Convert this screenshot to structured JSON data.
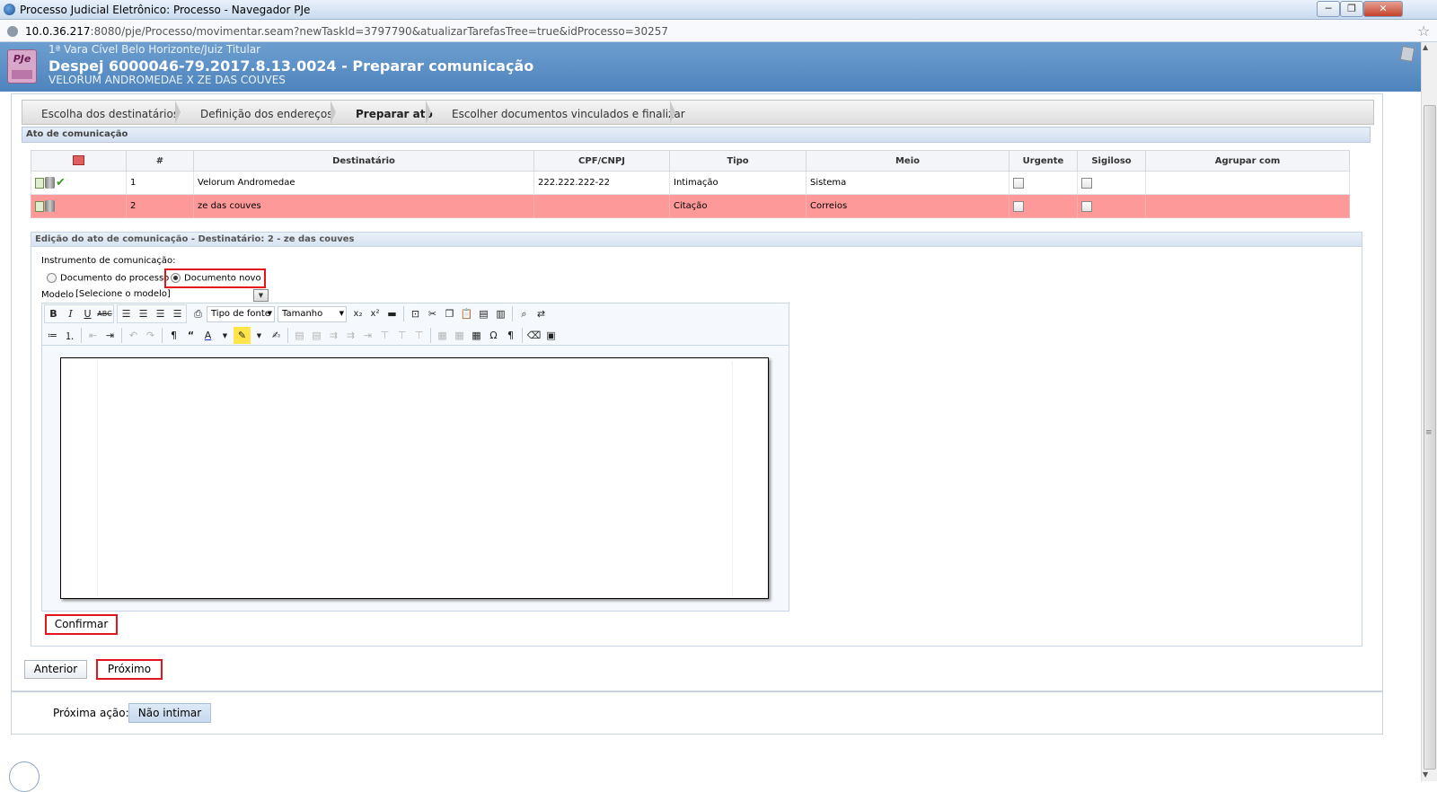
{
  "browser": {
    "window_title": "Processo Judicial Eletrônico: Processo - Navegador PJe",
    "url_host": "10.0.36.217",
    "url_rest": ":8080/pje/Processo/movimentar.seam?newTaskId=3797790&atualizarTarefasTree=true&idProcesso=30257",
    "win_min": "─",
    "win_max": "❐",
    "win_close": "✕"
  },
  "header": {
    "logo": "PJe",
    "orgao": "1ª Vara Cível Belo Horizonte/Juiz Titular",
    "title": "Despej 6000046-79.2017.8.13.0024 - Preparar comunicação",
    "partes": "VELORUM ANDROMEDAE X ZE DAS COUVES"
  },
  "steps": [
    {
      "label": "Escolha dos destinatários"
    },
    {
      "label": "Definição dos endereços"
    },
    {
      "label": "Preparar ato"
    },
    {
      "label": "Escolher documentos vinculados e finalizar"
    }
  ],
  "section_title": "Ato de comunicação",
  "table": {
    "headers": [
      "#",
      "Destinatário",
      "CPF/CNPJ",
      "Tipo",
      "Meio",
      "Urgente",
      "Sigiloso",
      "Agrupar com"
    ],
    "rows": [
      {
        "num": "1",
        "destinatario": "Velorum Andromedae",
        "cpf": "222.222.222-22",
        "tipo": "Intimação",
        "meio": "Sistema",
        "agrupar": ""
      },
      {
        "num": "2",
        "destinatario": "ze das couves",
        "cpf": "",
        "tipo": "Citação",
        "meio": "Correios",
        "agrupar": ""
      }
    ]
  },
  "edit": {
    "title": "Edição do ato de comunicação - Destinatário: 2 - ze das couves",
    "instrumento_label": "Instrumento de comunicação:",
    "radio_processo": "Documento do processo",
    "radio_novo": "Documento novo",
    "modelo_label": "Modelo",
    "modelo_value": "[Selecione o modelo]",
    "font_dropdown": "Tipo de fonte",
    "size_dropdown": "Tamanho"
  },
  "buttons": {
    "confirmar": "Confirmar",
    "anterior": "Anterior",
    "proximo": "Próximo"
  },
  "acao": {
    "label": "Próxima ação:",
    "button": "Não intimar"
  }
}
